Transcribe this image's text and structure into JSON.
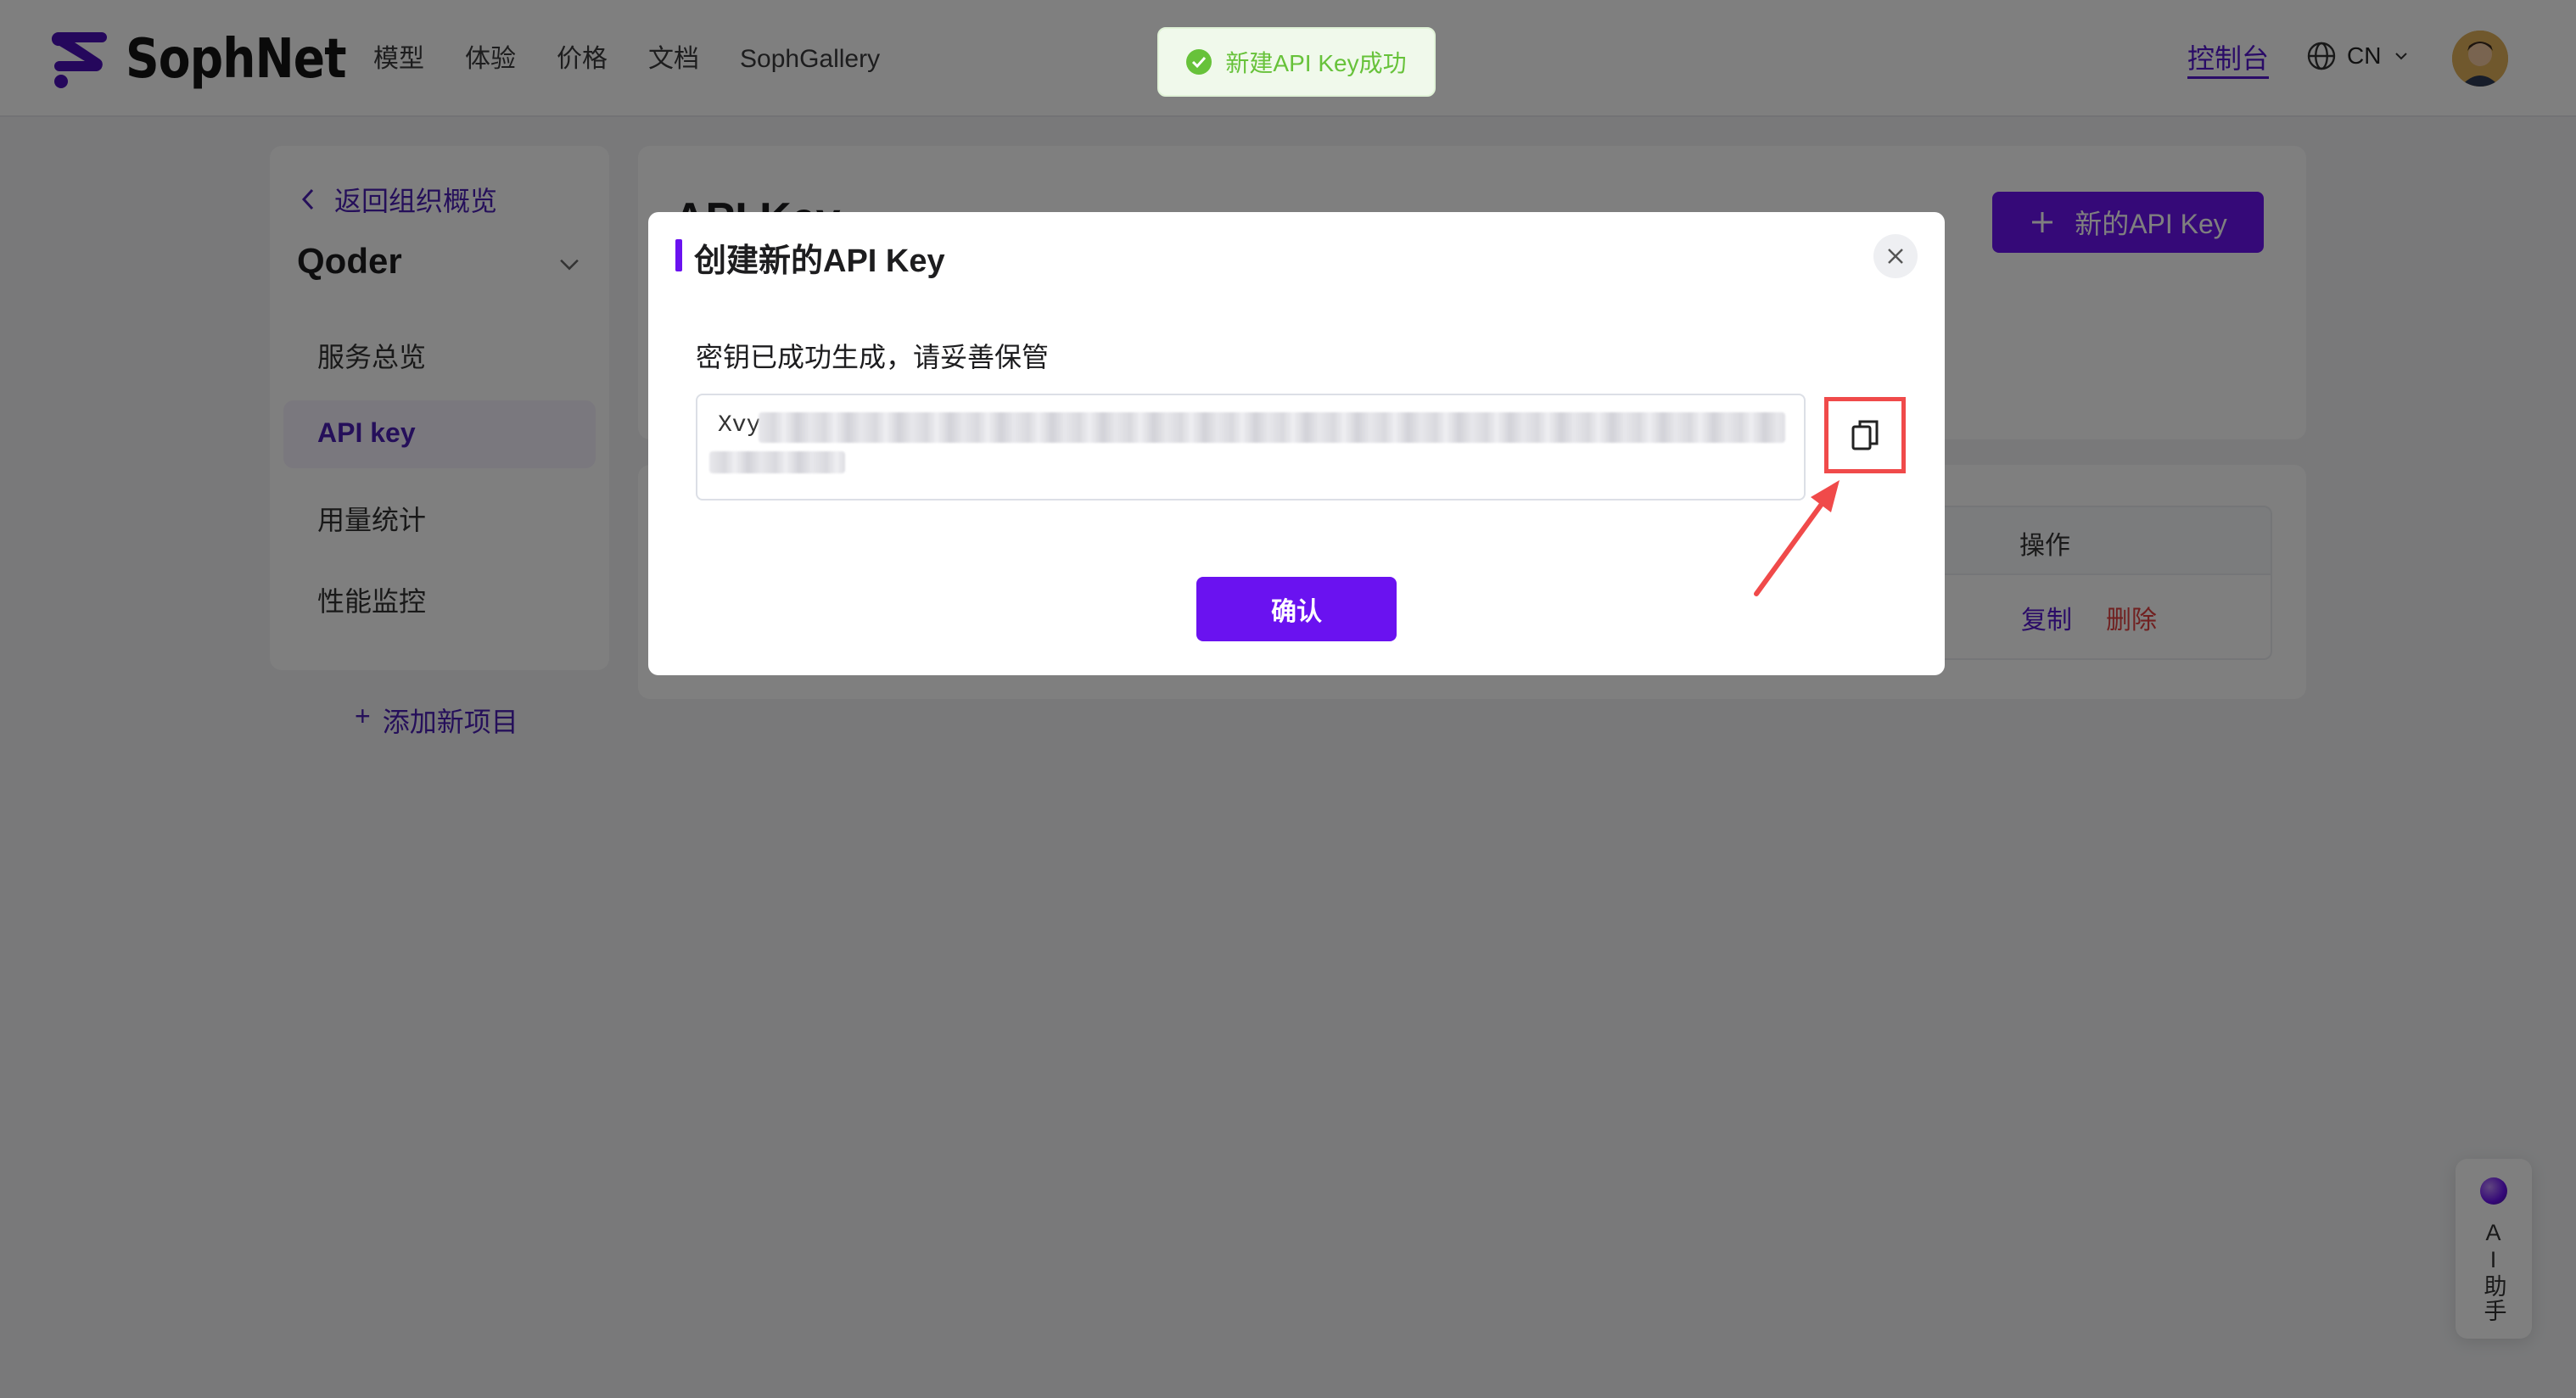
{
  "header": {
    "brand": "SophNet",
    "nav": [
      "模型",
      "体验",
      "价格",
      "文档",
      "SophGallery"
    ],
    "console_link": "控制台",
    "language": "CN"
  },
  "toast": {
    "message": "新建API Key成功",
    "status": "success"
  },
  "sidebar": {
    "back_label": "返回组织概览",
    "project_name": "Qoder",
    "items": [
      {
        "label": "服务总览",
        "active": false
      },
      {
        "label": "API key",
        "active": true
      },
      {
        "label": "用量统计",
        "active": false
      },
      {
        "label": "性能监控",
        "active": false
      }
    ],
    "add_project": "添加新项目"
  },
  "main": {
    "title": "API Key",
    "new_key_button": "新的API Key",
    "table": {
      "op_header": "操作",
      "row_actions": {
        "copy": "复制",
        "delete": "删除"
      }
    }
  },
  "modal": {
    "title": "创建新的API Key",
    "description": "密钥已成功生成，请妥善保管",
    "key_prefix": "Xvy",
    "confirm_button": "确认"
  },
  "ai_helper": {
    "label": "AI助手"
  },
  "colors": {
    "accent": "#6a12f0",
    "success": "#67c23a",
    "danger": "#e04040",
    "highlight": "#f04a4a"
  }
}
